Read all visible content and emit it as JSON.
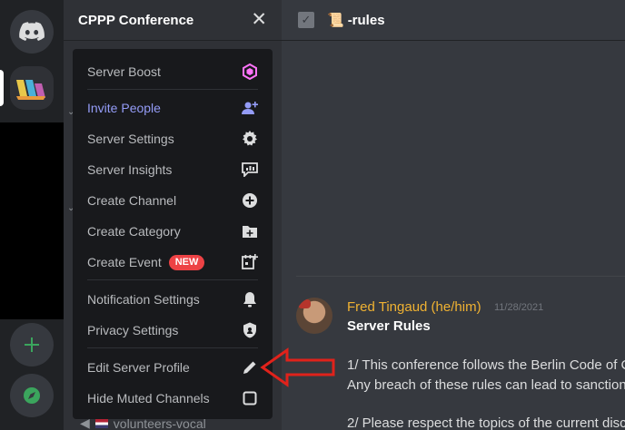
{
  "server": {
    "name": "CPPP Conference"
  },
  "menu": {
    "items": [
      {
        "label": "Server Boost",
        "icon": "boost-icon"
      },
      {
        "label": "Invite People",
        "icon": "invite-icon"
      },
      {
        "label": "Server Settings",
        "icon": "gear-icon"
      },
      {
        "label": "Server Insights",
        "icon": "insights-icon"
      },
      {
        "label": "Create Channel",
        "icon": "plus-circle-icon"
      },
      {
        "label": "Create Category",
        "icon": "folder-plus-icon"
      },
      {
        "label": "Create Event",
        "icon": "calendar-plus-icon",
        "badge": "NEW"
      },
      {
        "label": "Notification Settings",
        "icon": "bell-icon"
      },
      {
        "label": "Privacy Settings",
        "icon": "shield-icon"
      },
      {
        "label": "Edit Server Profile",
        "icon": "pencil-icon"
      },
      {
        "label": "Hide Muted Channels",
        "icon": "checkbox-icon"
      }
    ]
  },
  "channel": {
    "name": "-rules",
    "emoji": "📜"
  },
  "sidebar": {
    "bottom_channel": "volunteers-vocal"
  },
  "message": {
    "author": "Fred Tingaud (he/him)",
    "timestamp": "11/28/2021",
    "title": "Server Rules",
    "lines": [
      "1/ This conference follows the Berlin Code of C",
      "Any breach of these rules can lead to sanction",
      "2/ Please respect the topics of the current disc"
    ]
  },
  "colors": {
    "accent": "#5865f2",
    "invite": "#949cf7",
    "badge": "#ed4245",
    "author": "#f0b232",
    "boost": "#ff73fa",
    "green": "#3ba55d",
    "arrow": "#e0221b"
  }
}
